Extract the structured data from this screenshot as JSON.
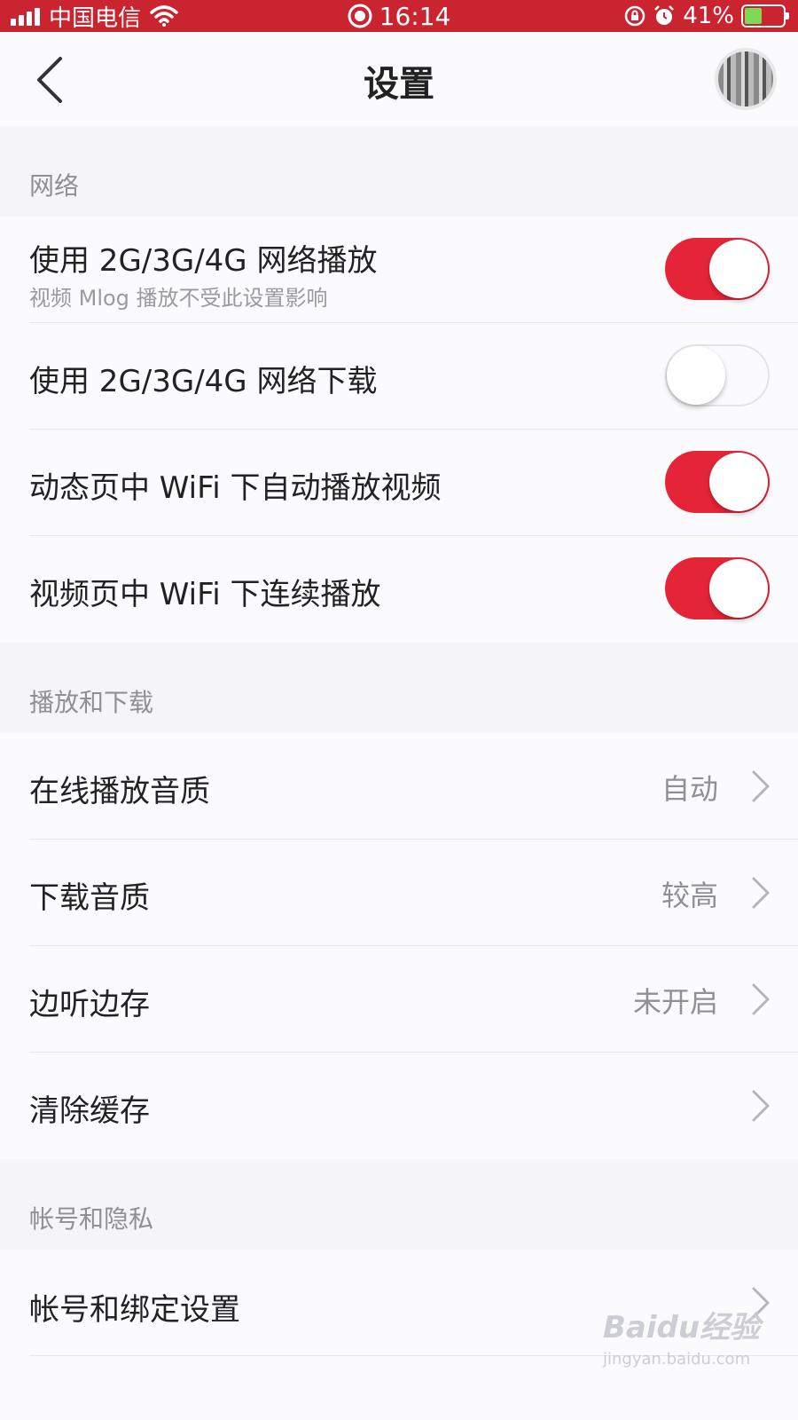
{
  "status_bar": {
    "carrier": "中国电信",
    "time": "16:14",
    "battery": "41%",
    "battery_level": 0.41
  },
  "header": {
    "title": "设置"
  },
  "sections": [
    {
      "title": "网络",
      "rows": [
        {
          "label": "使用 2G/3G/4G 网络播放",
          "sub": "视频 Mlog 播放不受此设置影响",
          "toggle": true
        },
        {
          "label": "使用 2G/3G/4G 网络下载",
          "toggle": false
        },
        {
          "label": "动态页中 WiFi 下自动播放视频",
          "toggle": true
        },
        {
          "label": "视频页中 WiFi 下连续播放",
          "toggle": true
        }
      ]
    },
    {
      "title": "播放和下载",
      "rows": [
        {
          "label": "在线播放音质",
          "value": "自动"
        },
        {
          "label": "下载音质",
          "value": "较高"
        },
        {
          "label": "边听边存",
          "value": "未开启"
        },
        {
          "label": "清除缓存",
          "value": ""
        }
      ]
    },
    {
      "title": "帐号和隐私",
      "rows": [
        {
          "label": "帐号和绑定设置",
          "value": ""
        }
      ]
    }
  ],
  "watermark": {
    "brand": "Baidu经验",
    "url": "jingyan.baidu.com"
  },
  "colors": {
    "status_bar": "#c9242f",
    "toggle_on": "#e42537",
    "background": "#f5f4f9"
  }
}
